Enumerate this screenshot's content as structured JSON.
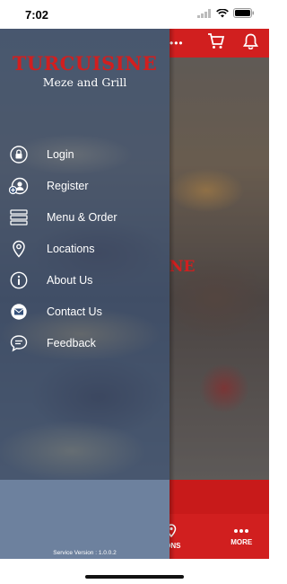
{
  "status_bar": {
    "time": "7:02"
  },
  "drawer": {
    "brand_title": "TURCUISINE",
    "brand_subtitle": "Meze and Grill",
    "items": [
      {
        "label": "Login",
        "icon": "lock-icon"
      },
      {
        "label": "Register",
        "icon": "add-user-icon"
      },
      {
        "label": "Menu & Order",
        "icon": "menu-list-icon"
      },
      {
        "label": "Locations",
        "icon": "location-pin-icon"
      },
      {
        "label": "About Us",
        "icon": "info-icon"
      },
      {
        "label": "Contact Us",
        "icon": "mail-icon"
      },
      {
        "label": "Feedback",
        "icon": "chat-icon"
      }
    ],
    "version": "Service Version : 1.0.0.2"
  },
  "background": {
    "peek_title": "NE",
    "tabs": [
      {
        "label": "TIONS",
        "icon": "location-pin-icon"
      },
      {
        "label": "MORE",
        "icon": "more-dots-icon"
      }
    ]
  },
  "colors": {
    "brand_red": "#d11f1f",
    "drawer_blue": "#34507a"
  }
}
